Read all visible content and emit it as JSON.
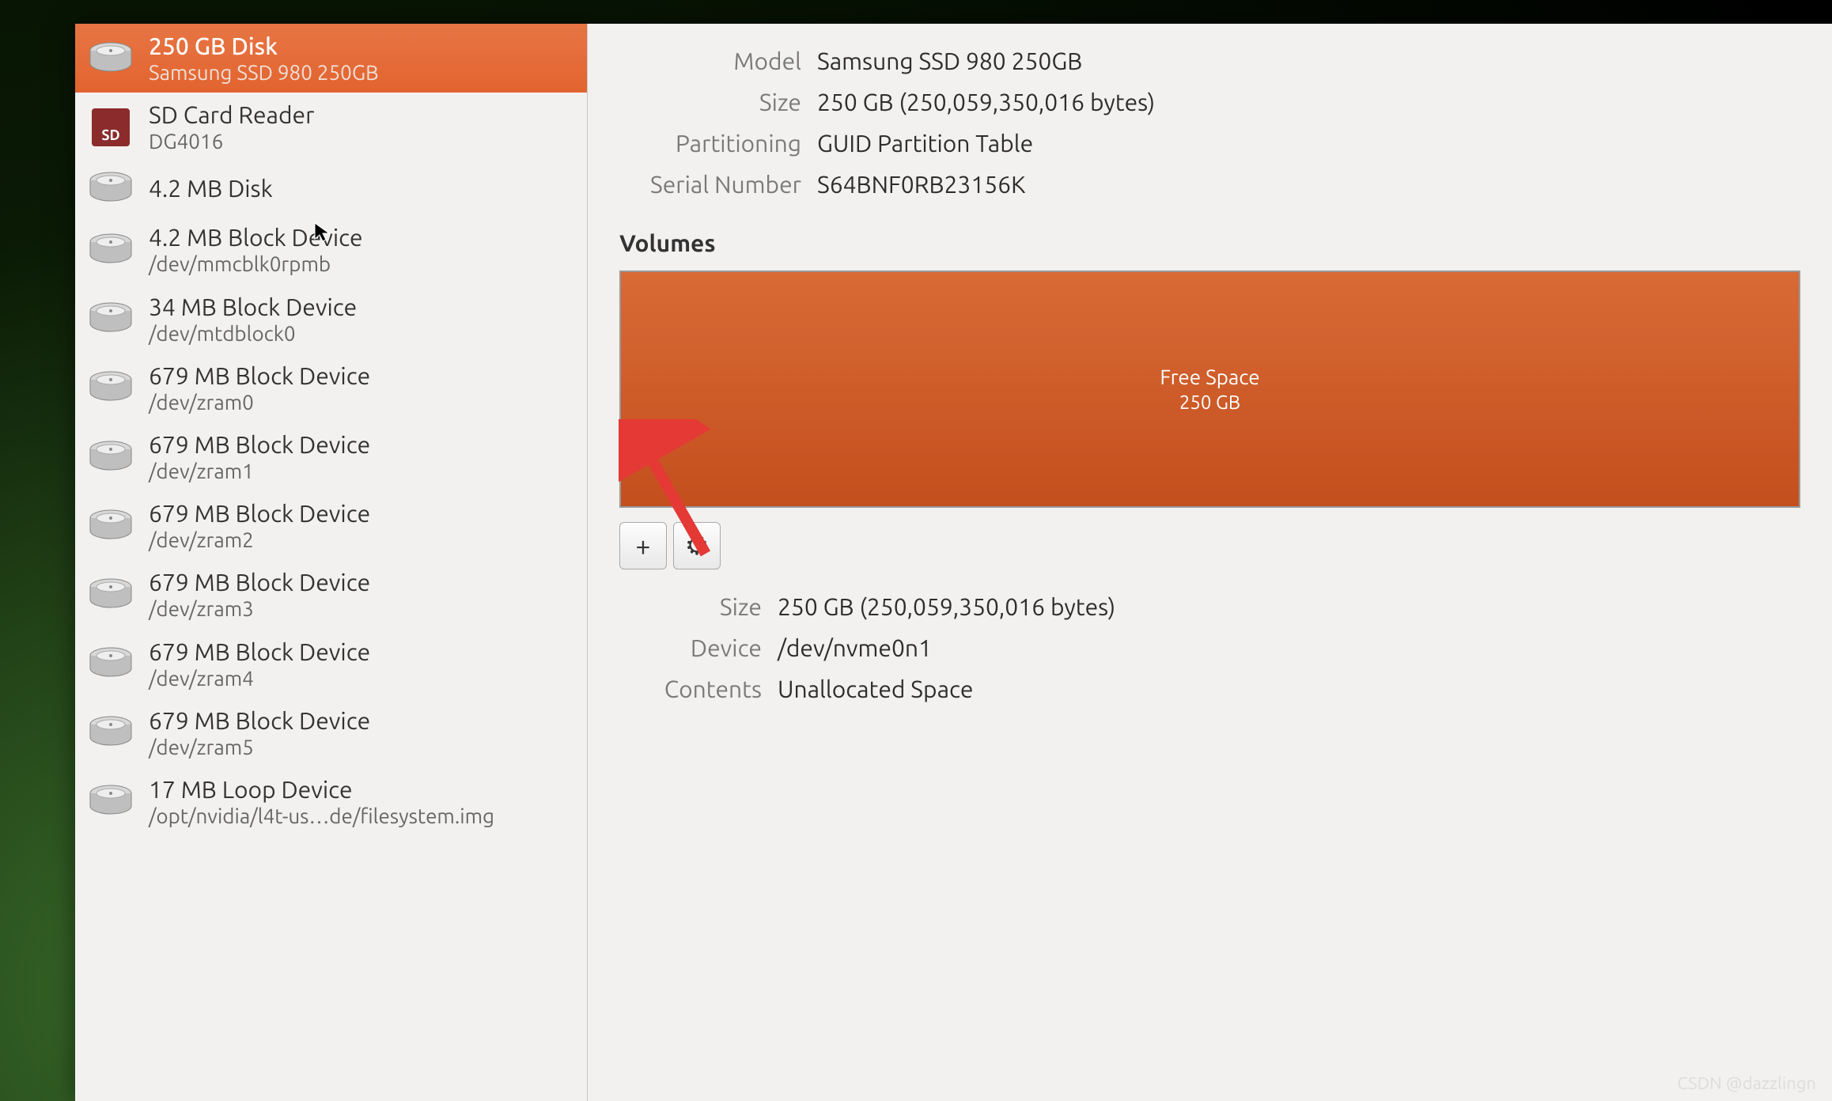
{
  "sidebar": {
    "items": [
      {
        "title": "250 GB Disk",
        "subtitle": "Samsung SSD 980 250GB",
        "icon": "disk",
        "selected": true
      },
      {
        "title": "SD Card Reader",
        "subtitle": "DG4016",
        "icon": "sd",
        "selected": false
      },
      {
        "title": "4.2 MB Disk",
        "subtitle": "",
        "icon": "disk",
        "selected": false
      },
      {
        "title": "4.2 MB Block Device",
        "subtitle": "/dev/mmcblk0rpmb",
        "icon": "disk",
        "selected": false
      },
      {
        "title": "34 MB Block Device",
        "subtitle": "/dev/mtdblock0",
        "icon": "disk",
        "selected": false
      },
      {
        "title": "679 MB Block Device",
        "subtitle": "/dev/zram0",
        "icon": "disk",
        "selected": false
      },
      {
        "title": "679 MB Block Device",
        "subtitle": "/dev/zram1",
        "icon": "disk",
        "selected": false
      },
      {
        "title": "679 MB Block Device",
        "subtitle": "/dev/zram2",
        "icon": "disk",
        "selected": false
      },
      {
        "title": "679 MB Block Device",
        "subtitle": "/dev/zram3",
        "icon": "disk",
        "selected": false
      },
      {
        "title": "679 MB Block Device",
        "subtitle": "/dev/zram4",
        "icon": "disk",
        "selected": false
      },
      {
        "title": "679 MB Block Device",
        "subtitle": "/dev/zram5",
        "icon": "disk",
        "selected": false
      },
      {
        "title": "17 MB Loop Device",
        "subtitle": "/opt/nvidia/l4t-us…de/filesystem.img",
        "icon": "disk",
        "selected": false
      }
    ]
  },
  "info": {
    "model_label": "Model",
    "model_value": "Samsung SSD 980 250GB",
    "size_label": "Size",
    "size_value": "250 GB (250,059,350,016 bytes)",
    "partitioning_label": "Partitioning",
    "partitioning_value": "GUID Partition Table",
    "serial_label": "Serial Number",
    "serial_value": "S64BNF0RB23156K"
  },
  "volumes": {
    "header": "Volumes",
    "block_title": "Free Space",
    "block_size": "250 GB"
  },
  "toolbar": {
    "add_label": "+",
    "gear_label": "⚙"
  },
  "details": {
    "size_label": "Size",
    "size_value": "250 GB (250,059,350,016 bytes)",
    "device_label": "Device",
    "device_value": "/dev/nvme0n1",
    "contents_label": "Contents",
    "contents_value": "Unallocated Space"
  },
  "sd_badge": "SD",
  "watermark": "CSDN @dazzlingn"
}
